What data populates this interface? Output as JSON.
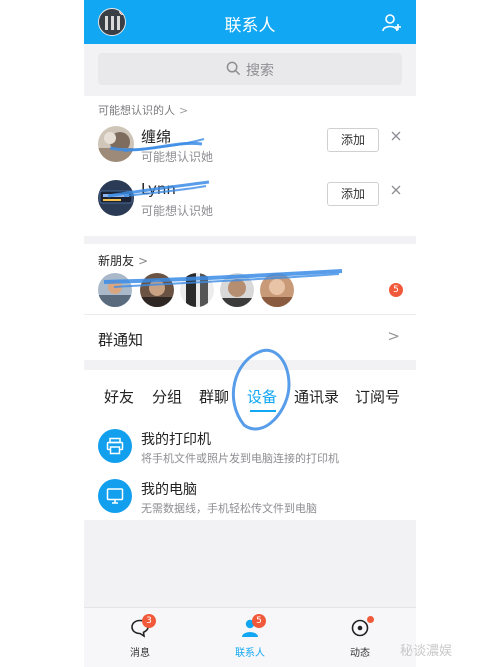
{
  "header": {
    "title": "联系人",
    "avatar_icon": "user-avatar",
    "add_friend_icon": "add-user-icon",
    "bg_color": "#11a7f2"
  },
  "search": {
    "placeholder": "搜索"
  },
  "recommend": {
    "section_title": "可能想认识的人",
    "chevron": ">",
    "people": [
      {
        "name": "缠绵",
        "subtitle": "可能想认识她",
        "add_label": "添加"
      },
      {
        "name": "Lynn",
        "subtitle": "可能想认识她",
        "add_label": "添加"
      }
    ]
  },
  "new_friends": {
    "label": "新朋友",
    "chevron": ">",
    "badge": "5"
  },
  "group_notice": {
    "label": "群通知",
    "chevron": ">"
  },
  "tabs": [
    {
      "label": "好友"
    },
    {
      "label": "分组"
    },
    {
      "label": "群聊"
    },
    {
      "label": "设备",
      "active": true
    },
    {
      "label": "通讯录"
    },
    {
      "label": "订阅号"
    }
  ],
  "devices": [
    {
      "name": "我的打印机",
      "desc": "将手机文件或照片发到电脑连接的打印机",
      "icon": "printer-icon"
    },
    {
      "name": "我的电脑",
      "desc": "无需数据线，手机轻松传文件到电脑",
      "icon": "computer-icon"
    }
  ],
  "bottom_nav": [
    {
      "label": "消息",
      "badge": "3",
      "icon": "message-icon"
    },
    {
      "label": "联系人",
      "badge": "5",
      "icon": "contacts-icon",
      "active": true
    },
    {
      "label": "动态",
      "dot": true,
      "icon": "activity-icon"
    }
  ],
  "watermark": "秘谈濃娱",
  "accent_color": "#11a7f2",
  "badge_color": "#f05a3a"
}
